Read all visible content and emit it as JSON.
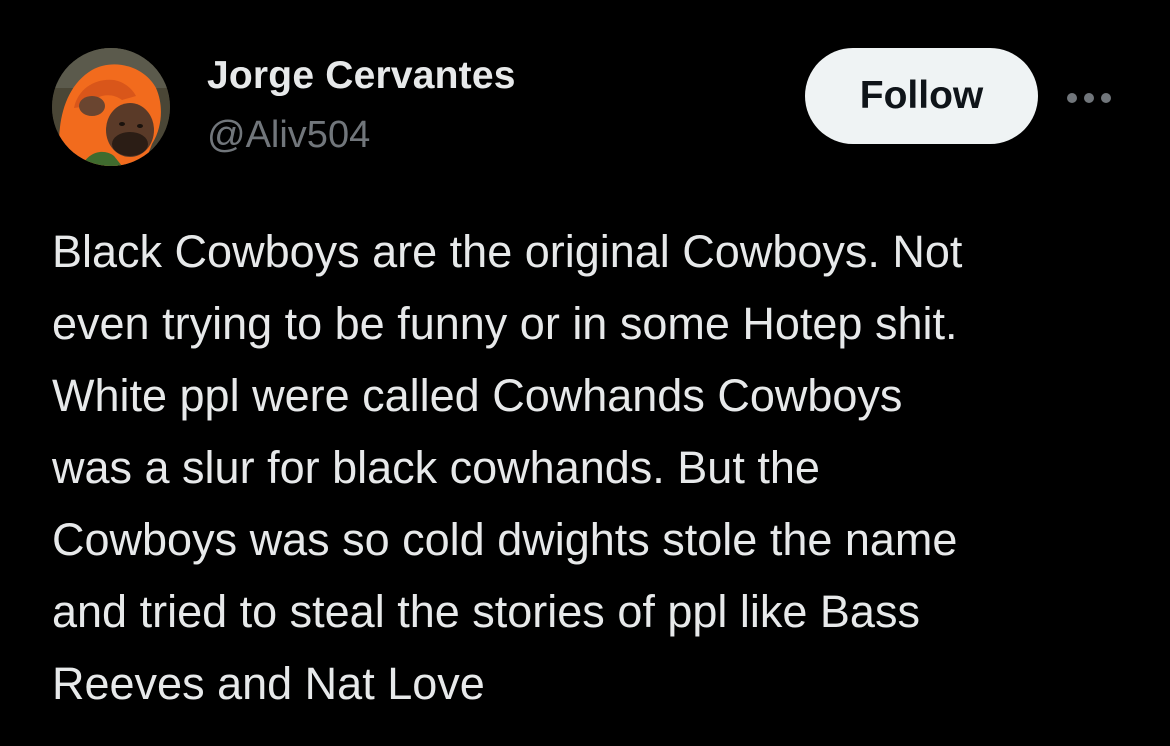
{
  "user": {
    "display_name": "Jorge Cervantes",
    "handle": "@Aliv504",
    "avatar_icon": "profile-photo"
  },
  "actions": {
    "follow_label": "Follow",
    "more_icon": "more-horizontal-icon"
  },
  "tweet": {
    "lines": [
      "Black Cowboys are the original Cowboys. Not",
      "even trying to be funny or in some Hotep shit.",
      "White ppl were called Cowhands Cowboys",
      "was a slur for black cowhands. But the",
      "Cowboys was so cold dwights stole the name",
      "and tried to steal the stories of ppl like Bass",
      "Reeves and Nat Love"
    ]
  },
  "colors": {
    "background": "#000000",
    "text_primary": "#e7e9ea",
    "text_secondary": "#71767b",
    "follow_bg": "#eff3f4",
    "follow_text": "#0f1419",
    "avatar_hood": "#f26b1d"
  }
}
